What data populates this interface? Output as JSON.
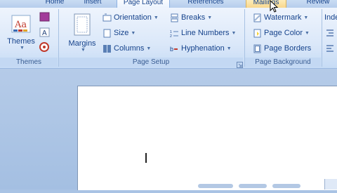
{
  "tabs": [
    "Home",
    "Insert",
    "Page Layout",
    "References",
    "Mailings",
    "Review"
  ],
  "groups": {
    "themes": {
      "label": "Themes",
      "button": "Themes"
    },
    "page_setup": {
      "label": "Page Setup",
      "margins": "Margins",
      "orientation": "Orientation",
      "size": "Size",
      "columns": "Columns",
      "breaks": "Breaks",
      "line_numbers": "Line Numbers",
      "hyphenation": "Hyphenation"
    },
    "page_background": {
      "label": "Page Background",
      "watermark": "Watermark",
      "page_color": "Page Color",
      "page_borders": "Page Borders"
    },
    "indent": {
      "label": "Inde"
    }
  },
  "colors": {
    "ribbon": "#dbe8f9",
    "accent": "#15428b",
    "document": "#ffffff"
  }
}
